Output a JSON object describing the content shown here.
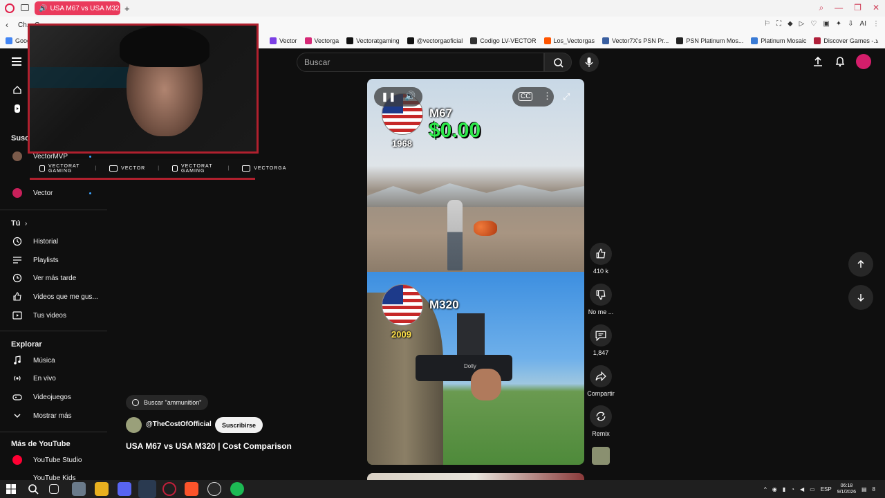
{
  "browser": {
    "tab_title": "USA M67 vs USA M32...",
    "address_partial": "Ch... G...",
    "bookmarks": [
      {
        "label": "Goog",
        "color": "#4285f4"
      },
      {
        "label": "Vector",
        "color": "#7b3fe4"
      },
      {
        "label": "Vectorga",
        "color": "#d62976"
      },
      {
        "label": "Vectoratgaming",
        "color": "#111111"
      },
      {
        "label": "@vectorgaoficial",
        "color": "#111111"
      },
      {
        "label": "Codigo LV-VECTOR",
        "color": "#333333"
      },
      {
        "label": "Los_Vectorgas",
        "color": "#ff5500"
      },
      {
        "label": "Vector7X's PSN Pr...",
        "color": "#3a5fa0"
      },
      {
        "label": "PSN Platinum Mos...",
        "color": "#222222"
      },
      {
        "label": "Platinum Mosaic",
        "color": "#3a7bd5"
      },
      {
        "label": "Discover Games -...",
        "color": "#b0203a"
      }
    ],
    "toolbar_ai_label": "AI"
  },
  "header": {
    "search_placeholder": "Buscar"
  },
  "sidebar": {
    "subscriptions_title": "Susc",
    "subscriptions": [
      {
        "label": "VectorMVP"
      },
      {
        "label": "Vector"
      }
    ],
    "you_title": "Tú",
    "you_items": [
      {
        "label": "Historial",
        "icon": "history-icon"
      },
      {
        "label": "Playlists",
        "icon": "playlist-icon"
      },
      {
        "label": "Ver más tarde",
        "icon": "clock-icon"
      },
      {
        "label": "Videos que me gus...",
        "icon": "like-icon"
      },
      {
        "label": "Tus videos",
        "icon": "video-icon"
      }
    ],
    "explore_title": "Explorar",
    "explore_items": [
      {
        "label": "Música",
        "icon": "music-icon"
      },
      {
        "label": "En vivo",
        "icon": "live-icon"
      },
      {
        "label": "Videojuegos",
        "icon": "gamepad-icon"
      },
      {
        "label": "Mostrar más",
        "icon": "chevron-down-icon"
      }
    ],
    "more_title": "Más de YouTube",
    "more_items": [
      {
        "label": "YouTube Studio"
      },
      {
        "label": "YouTube Kids"
      }
    ]
  },
  "webcam": {
    "socials": [
      "VECTORAT GAMING",
      "VECTOR",
      "VECTORAT GAMING",
      "VECTORGA"
    ]
  },
  "short": {
    "top_label": "M67",
    "top_year": "1968",
    "top_cost": "$0.00",
    "bottom_label": "M320",
    "bottom_year": "2009",
    "gun_text": "Dolly"
  },
  "actions": {
    "likes": "410 k",
    "dislike_label": "No me ...",
    "comments": "1,847",
    "share_label": "Compartir",
    "remix_label": "Remix"
  },
  "video": {
    "search_chip": "Buscar \"ammunition\"",
    "channel": "@TheCostOfOfficial",
    "subscribe_label": "Suscribirse",
    "title": "USA M67 vs USA M320 | Cost Comparison"
  },
  "taskbar": {
    "lang": "ESP",
    "time": "06:18",
    "date": "9/1/2026",
    "notifications": "8"
  }
}
